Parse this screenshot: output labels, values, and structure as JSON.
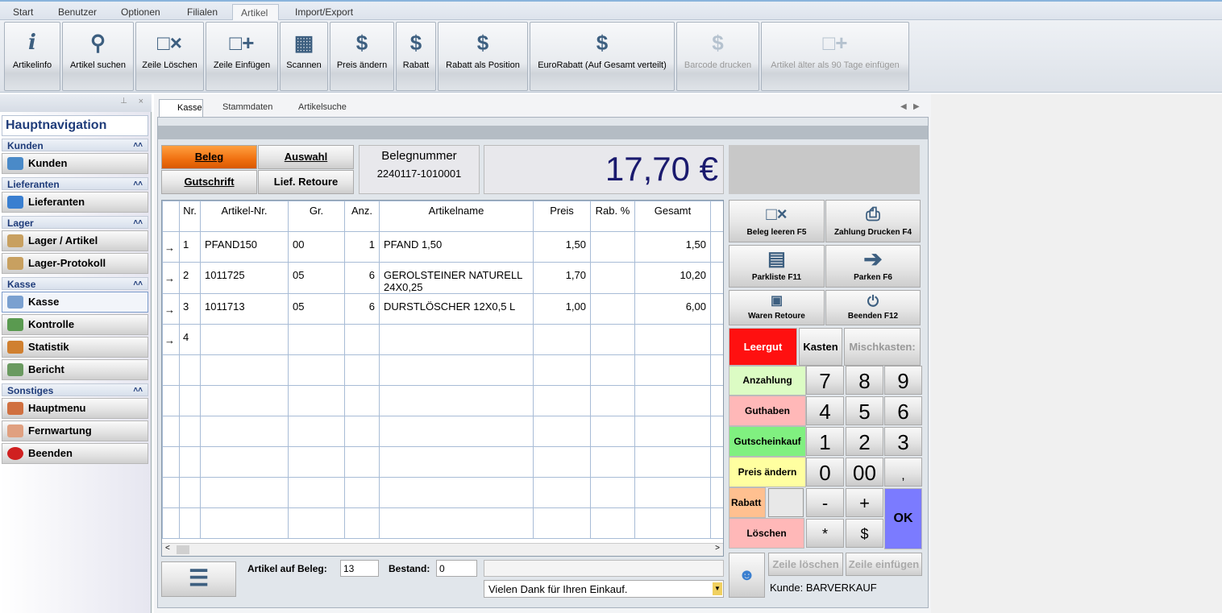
{
  "ribbon": {
    "tabs": [
      "Start",
      "Benutzer",
      "Optionen",
      "Filialen",
      "Artikel",
      "Import/Export"
    ],
    "active": "Artikel"
  },
  "toolbar": [
    {
      "label": "Artikelinfo",
      "icon": "info-icon"
    },
    {
      "label": "Artikel suchen",
      "icon": "magnifier-icon"
    },
    {
      "label": "Zeile Löschen",
      "icon": "delete-row-icon"
    },
    {
      "label": "Zeile Einfügen",
      "icon": "insert-row-icon"
    },
    {
      "label": "Scannen",
      "icon": "barcode-icon"
    },
    {
      "label": "Preis ändern",
      "icon": "dollar-icon"
    },
    {
      "label": "Rabatt",
      "icon": "dollar-icon"
    },
    {
      "label": "Rabatt als Position",
      "icon": "dollar-icon"
    },
    {
      "label": "EuroRabatt (Auf Gesamt verteilt)",
      "icon": "dollar-icon"
    },
    {
      "label": "Barcode drucken",
      "icon": "dollar-icon",
      "disabled": true
    },
    {
      "label": "Artikel älter als 90 Tage einfügen",
      "icon": "insert-row-icon",
      "disabled": true
    }
  ],
  "nav": {
    "title": "Hauptnavigation",
    "groups": {
      "kunden": "Kunden",
      "lieferanten": "Lieferanten",
      "lager": "Lager",
      "kasse": "Kasse",
      "sonstiges": "Sonstiges"
    },
    "items": {
      "kunden": "Kunden",
      "lieferanten": "Lieferanten",
      "lager_artikel": "Lager / Artikel",
      "lager_protokoll": "Lager-Protokoll",
      "kasse": "Kasse",
      "kontrolle": "Kontrolle",
      "statistik": "Statistik",
      "bericht": "Bericht",
      "hauptmenu": "Hauptmenu",
      "fernwartung": "Fernwartung",
      "beenden": "Beenden"
    }
  },
  "doctabs": [
    "Kasse",
    "Stammdaten",
    "Artikelsuche"
  ],
  "mode": {
    "beleg": "Beleg",
    "auswahl": "Auswahl",
    "gutschrift": "Gutschrift",
    "lief_retoure": "Lief. Retoure"
  },
  "belegnummer": {
    "label": "Belegnummer",
    "value": "2240117-1010001"
  },
  "total": "17,70 €",
  "table": {
    "headers": [
      "Nr.",
      "Artikel-Nr.",
      "Gr.",
      "Anz.",
      "Artikelname",
      "Preis",
      "Rab. %",
      "Gesamt"
    ],
    "rows": [
      [
        "1",
        "PFAND150",
        "00",
        "1",
        "PFAND 1,50",
        "1,50",
        "",
        "1,50"
      ],
      [
        "2",
        "1011725",
        "05",
        "6",
        "GEROLSTEINER NATURELL 24X0,25",
        "1,70",
        "",
        "10,20"
      ],
      [
        "3",
        "1011713",
        "05",
        "6",
        "DURSTLÖSCHER 12X0,5 L",
        "1,00",
        "",
        "6,00"
      ],
      [
        "4",
        "",
        "",
        "",
        "",
        "",
        "",
        ""
      ]
    ]
  },
  "footer": {
    "artikel_label": "Artikel auf Beleg:",
    "artikel_value": "13",
    "bestand_label": "Bestand:",
    "bestand_value": "0",
    "message": "Vielen Dank für Ihren Einkauf."
  },
  "actions": {
    "beleg_leeren": "Beleg leeren F5",
    "zahlung_drucken": "Zahlung Drucken F4",
    "parkliste": "Parkliste F11",
    "parken": "Parken F6",
    "waren_retoure": "Waren Retoure",
    "beenden": "Beenden  F12"
  },
  "keypad": {
    "leergut": "Leergut",
    "kasten": "Kasten",
    "mischkasten": "Mischkasten:",
    "anzahlung": "Anzahlung",
    "guthaben": "Guthaben",
    "gutscheinkauf": "Gutscheinkauf",
    "preis_aendern": "Preis ändern",
    "rabatt": "Rabatt",
    "loeschen": "Löschen",
    "ok": "OK",
    "keys": [
      "7",
      "8",
      "9",
      "4",
      "5",
      "6",
      "1",
      "2",
      "3",
      "0",
      "00",
      ",",
      "-",
      "+",
      "*",
      "$"
    ]
  },
  "bottom": {
    "zeile_loeschen": "Zeile löschen",
    "zeile_einfuegen": "Zeile einfügen",
    "kunde": "Kunde: BARVERKAUF"
  },
  "colors": {
    "leergut": "#ff1010",
    "anzahlung": "#dcfcc4",
    "guthaben": "#ffb8b8",
    "gutscheinkauf": "#80f080",
    "preis": "#ffffa0",
    "rabatt": "#ffc090",
    "ok": "#7b7bff",
    "total": "#1a1a6e"
  }
}
